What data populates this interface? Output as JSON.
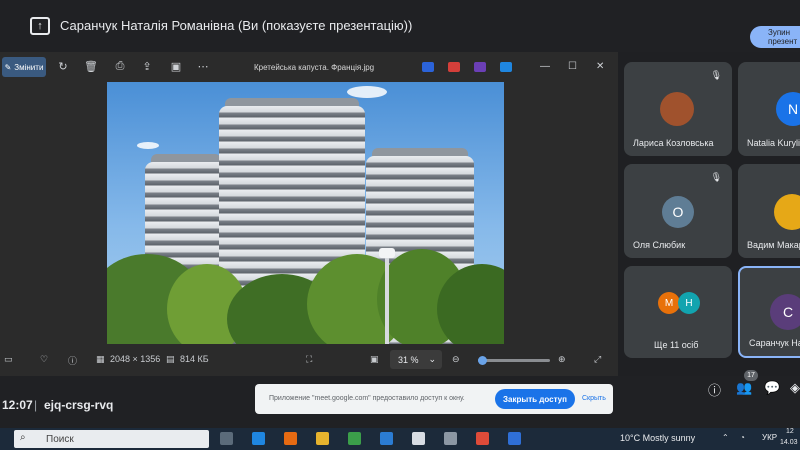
{
  "meet": {
    "presenter_title": "Саранчук Наталія Романівна (Ви (показуєте презентацію))",
    "stop_button_label": "Зупин презент",
    "time": "12:07",
    "separator": "|",
    "code": "ejq-crsg-rvq",
    "chat_badge": "17"
  },
  "viewer": {
    "edit_label": "Змінити",
    "file_name": "Кретейська капуста. Франція.jpg",
    "dimensions": "2048 × 1356",
    "file_size": "814 КБ",
    "zoom": "31 %",
    "zoom_fraction": 0.05
  },
  "participants": [
    {
      "name": "Лариса Козловська",
      "initial": "",
      "avatar_color": "#a0522d",
      "muted": true
    },
    {
      "name": "Natalia Kurylia",
      "initial": "N",
      "avatar_color": "#1a73e8",
      "muted": false
    },
    {
      "name": "Оля Слюбик",
      "initial": "О",
      "avatar_color": "#5f7d95",
      "muted": true
    },
    {
      "name": "Вадим Макар",
      "initial": "",
      "avatar_color": "#e6a817",
      "muted": false
    },
    {
      "name": "Ще 11 осіб",
      "initial_a": "М",
      "initial_b": "Н",
      "color_a": "#e8710a",
      "color_b": "#12a4af"
    },
    {
      "name": "Саранчук Нат",
      "initial": "С",
      "avatar_color": "#5a3d7a",
      "muted": false
    }
  ],
  "notice": {
    "text": "Приложение \"meet.google.com\" предоставило доступ к окну.",
    "share_button": "Закрыть доступ",
    "hide_link": "Скрыть"
  },
  "taskbar": {
    "search_placeholder": "Поиск",
    "weather": "10°C  Mostly sunny",
    "language": "УКР",
    "time": "12",
    "date": "14.03"
  },
  "colors": {
    "accent": "#8ab4f8",
    "tile_bg": "#3c4043",
    "meet_bg": "#202124"
  }
}
